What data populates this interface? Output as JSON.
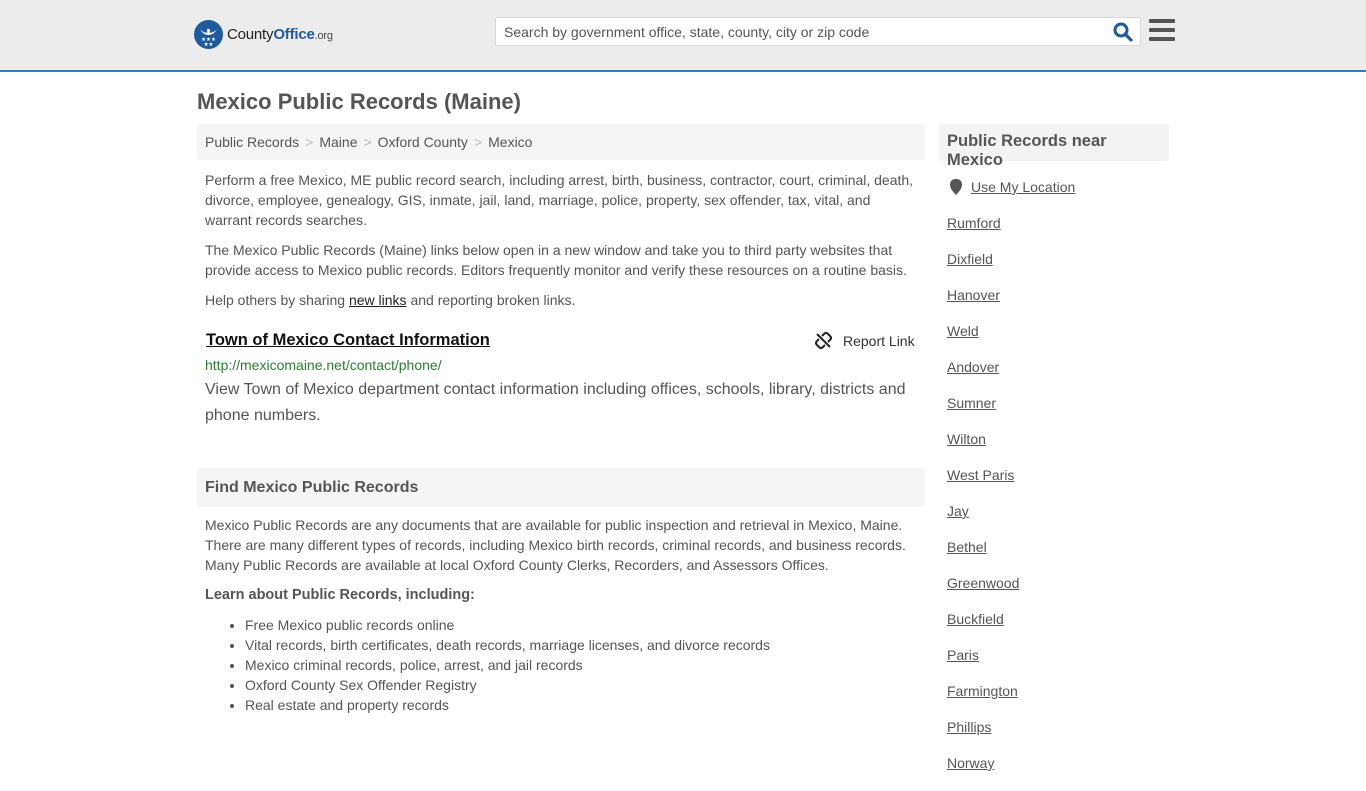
{
  "header": {
    "logo": {
      "name_main": "County",
      "name_brand": "Office",
      "name_suffix": ".org"
    },
    "search": {
      "placeholder": "Search by government office, state, county, city or zip code",
      "value": ""
    },
    "icons": {
      "search": "search-icon",
      "menu": "hamburger-menu-icon"
    },
    "accent_color": "#337ab7"
  },
  "page": {
    "title": "Mexico Public Records (Maine)"
  },
  "breadcrumb": [
    {
      "label": "Public Records"
    },
    {
      "label": "Maine"
    },
    {
      "label": "Oxford County"
    },
    {
      "label": "Mexico"
    }
  ],
  "breadcrumb_separator": ">",
  "intro": {
    "p1": "Perform a free Mexico, ME public record search, including arrest, birth, business, contractor, court, criminal, death, divorce, employee, genealogy, GIS, inmate, jail, land, marriage, police, property, sex offender, tax, vital, and warrant records searches.",
    "p2": "The Mexico Public Records (Maine) links below open in a new window and take you to third party websites that provide access to Mexico public records. Editors frequently monitor and verify these resources on a routine basis.",
    "p3_before": "Help others by sharing ",
    "p3_link": "new links",
    "p3_after": " and reporting broken links."
  },
  "result": {
    "title": "Town of Mexico Contact Information",
    "url": "http://mexicomaine.net/contact/phone/",
    "description": "View Town of Mexico department contact information including offices, schools, library, districts and phone numbers.",
    "report_label": "Report Link",
    "url_color": "#2e7d32"
  },
  "find_section": {
    "heading": "Find Mexico Public Records",
    "body": "Mexico Public Records are any documents that are available for public inspection and retrieval in Mexico, Maine. There are many different types of records, including Mexico birth records, criminal records, and business records. Many Public Records are available at local Oxford County Clerks, Recorders, and Assessors Offices.",
    "learn_heading": "Learn about Public Records, including:",
    "learn_items": [
      "Free Mexico public records online",
      "Vital records, birth certificates, death records, marriage licenses, and divorce records",
      "Mexico criminal records, police, arrest, and jail records",
      "Oxford County Sex Offender Registry",
      "Real estate and property records"
    ]
  },
  "sidebar": {
    "heading": "Public Records near Mexico",
    "use_location": "Use My Location",
    "nearby": [
      "Rumford",
      "Dixfield",
      "Hanover",
      "Weld",
      "Andover",
      "Sumner",
      "Wilton",
      "West Paris",
      "Jay",
      "Bethel",
      "Greenwood",
      "Buckfield",
      "Paris",
      "Farmington",
      "Phillips",
      "Norway"
    ]
  }
}
